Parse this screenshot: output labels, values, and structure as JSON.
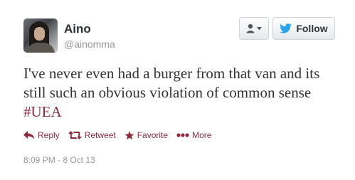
{
  "author": {
    "name": "Aino",
    "handle": "@ainomma"
  },
  "header": {
    "follow_label": "Follow"
  },
  "tweet": {
    "text": "I've never even had a burger from that van and its still such an obvious violation of common sense ",
    "hashtag": "#UEA"
  },
  "actions": {
    "reply": "Reply",
    "retweet": "Retweet",
    "favorite": "Favorite",
    "more": "More"
  },
  "timestamp": "8:09 PM - 8 Oct 13",
  "colors": {
    "link": "#8e2a3e",
    "twitter_blue": "#2aa3ef",
    "muted": "#999999"
  },
  "icons": {
    "user_menu": "person-icon",
    "follow": "twitter-bird-icon",
    "reply": "reply-arrow-icon",
    "retweet": "retweet-icon",
    "favorite": "star-icon",
    "more": "dots-icon"
  }
}
